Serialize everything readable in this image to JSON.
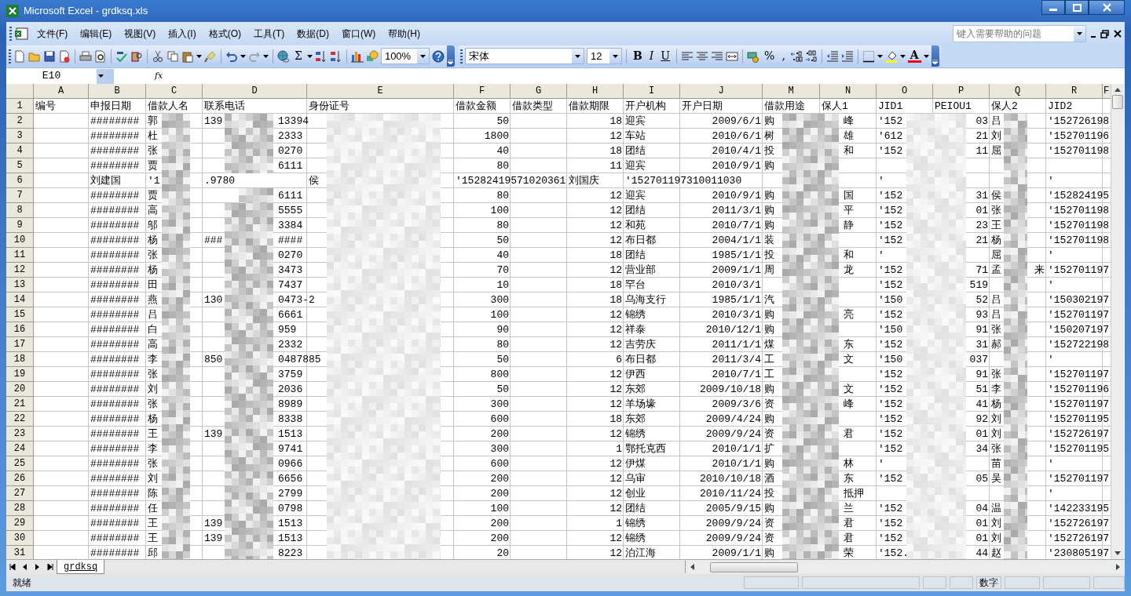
{
  "window": {
    "title": "Microsoft Excel - grdksq.xls"
  },
  "menu": [
    "文件(F)",
    "编辑(E)",
    "视图(V)",
    "插入(I)",
    "格式(O)",
    "工具(T)",
    "数据(D)",
    "窗口(W)",
    "帮助(H)"
  ],
  "help_box": {
    "placeholder": "键入需要帮助的问题"
  },
  "standard_toolbar": {
    "autosum": "Σ",
    "zoom": "100%"
  },
  "formatting_toolbar": {
    "font": "宋体",
    "size": "12",
    "styles": [
      "B",
      "I",
      "U"
    ],
    "number_formats": [
      "%",
      ","
    ],
    "font_color": "A"
  },
  "formula_bar": {
    "name_box": "E10",
    "fx": "fx"
  },
  "sheet": {
    "columns": [
      "A",
      "B",
      "C",
      "D",
      "E",
      "F",
      "G",
      "H",
      "I",
      "J",
      "M",
      "N",
      "O",
      "P",
      "Q",
      "R",
      "F"
    ],
    "rows": [
      {
        "num": "1",
        "kind": "header",
        "a": "编号",
        "b": "申报日期",
        "c": "借款人名",
        "d": "联系电话",
        "e": "身份证号",
        "f": "借款金额",
        "g": "借款类型",
        "h": "借款期限",
        "i": "开户机构",
        "j": "开户日期",
        "m": "借款用途",
        "n": "保人1",
        "o": "JID1",
        "p": "PEIOU1",
        "q": "保人2",
        "r": "JID2"
      },
      {
        "num": "2",
        "kind": "normal",
        "b": "########",
        "c": "郭",
        "d": "139",
        "d_end": "13394",
        "f": "50",
        "h": "18",
        "i": "迎宾",
        "j": "2009/6/1",
        "m": "购",
        "n": "峰",
        "o": "'152",
        "p": "03",
        "q": "吕",
        "r": "'152726198"
      },
      {
        "num": "3",
        "kind": "normal",
        "b": "########",
        "c": "杜",
        "d_end": "2333",
        "f": "1800",
        "h": "12",
        "i": "车站",
        "j": "2010/6/1",
        "m": "树",
        "n": "雄",
        "o": "'612",
        "p": "21",
        "q": "刘",
        "r": "'152701196"
      },
      {
        "num": "4",
        "kind": "normal",
        "b": "########",
        "c": "张",
        "d_end": "0270",
        "f": "40",
        "h": "18",
        "i": "团结",
        "j": "2010/4/1",
        "m": "投",
        "n": "和",
        "o": "'152",
        "p": "11",
        "q": "屈",
        "r": "'152701198"
      },
      {
        "num": "5",
        "kind": "normal",
        "b": "########",
        "c": "贾",
        "d_end": "6111",
        "f": "80",
        "h": "11",
        "i": "迎宾",
        "j": "2010/9/1",
        "m": "购"
      },
      {
        "num": "6",
        "kind": "shifted",
        "b": "刘建国",
        "c": "'1",
        "d": ".9780",
        "e": "侯",
        "f": "'15282419571020361",
        "h": "刘国庆",
        "i": "'152701197310011030",
        "o": "'",
        "r": "'"
      },
      {
        "num": "7",
        "kind": "normal",
        "b": "########",
        "c": "贾",
        "d_end": "6111",
        "f": "80",
        "h": "12",
        "i": "迎宾",
        "j": "2010/9/1",
        "m": "购",
        "n": "国",
        "o": "'152",
        "p": "31",
        "q": "侯",
        "r": "'152824195"
      },
      {
        "num": "8",
        "kind": "normal",
        "b": "########",
        "c": "高",
        "d_end": "5555",
        "f": "100",
        "h": "12",
        "i": "团结",
        "j": "2011/3/1",
        "m": "购",
        "n": "平",
        "o": "'152",
        "p": "01",
        "q": "张",
        "r": "'152701198"
      },
      {
        "num": "9",
        "kind": "normal",
        "b": "########",
        "c": "邬",
        "d_end": "3384",
        "f": "80",
        "h": "12",
        "i": "和苑",
        "j": "2010/7/1",
        "m": "购",
        "n": "静",
        "o": "'152",
        "p": "23",
        "q": "王",
        "r": "'152701198"
      },
      {
        "num": "10",
        "kind": "normal",
        "b": "########",
        "c": "杨",
        "d": "###",
        "d_end": "####",
        "f": "50",
        "h": "12",
        "i": "布日都",
        "j": "2004/1/1",
        "m": "装",
        "o": "'152",
        "p": "21",
        "q": "杨",
        "r": "'152701198"
      },
      {
        "num": "11",
        "kind": "normal",
        "b": "########",
        "c": "张",
        "d_end": "0270",
        "f": "40",
        "h": "18",
        "i": "团结",
        "j": "1985/1/1",
        "m": "投",
        "n": "和",
        "o": "'",
        "q": "屈",
        "r": "'"
      },
      {
        "num": "12",
        "kind": "normal",
        "b": "########",
        "c": "杨",
        "d_end": "3473",
        "f": "70",
        "h": "12",
        "i": "营业部",
        "j": "2009/1/1",
        "m": "周",
        "n": "龙",
        "o": "'152",
        "p": "71",
        "q": "孟",
        "q_end": "来",
        "r": "'152701197"
      },
      {
        "num": "13",
        "kind": "normal",
        "b": "########",
        "c": "田",
        "d_end": "7437",
        "f": "10",
        "h": "18",
        "i": "罕台",
        "j": "2010/3/1",
        "o": "'152",
        "p": "519",
        "r": "'"
      },
      {
        "num": "14",
        "kind": "normal",
        "b": "########",
        "c": "燕",
        "d": "130",
        "d_end": "0473-2",
        "f": "300",
        "h": "18",
        "i": "乌海支行",
        "j": "1985/1/1",
        "m": "汽",
        "o": "'150",
        "p": "52",
        "q": "吕",
        "r": "'150302197"
      },
      {
        "num": "15",
        "kind": "normal",
        "b": "########",
        "c": "吕",
        "d_end": "6661",
        "f": "100",
        "h": "12",
        "i": "锦绣",
        "j": "2010/3/1",
        "m": "购",
        "n": "亮",
        "o": "'152",
        "p": "93",
        "q": "吕",
        "r": "'152701197"
      },
      {
        "num": "16",
        "kind": "normal",
        "b": "########",
        "c": "白",
        "d_end": "959",
        "f": "90",
        "h": "12",
        "i": "祥泰",
        "j": "2010/12/1",
        "m": "购",
        "o": "'150",
        "p": "91",
        "q": "张",
        "r": "'150207197"
      },
      {
        "num": "17",
        "kind": "normal",
        "b": "########",
        "c": "高",
        "d_end": "2332",
        "f": "80",
        "h": "12",
        "i": "吉劳庆",
        "j": "2011/1/1",
        "m": "煤",
        "n": "东",
        "o": "'152",
        "p": "31",
        "q": "郝",
        "r": "'152722198"
      },
      {
        "num": "18",
        "kind": "normal",
        "b": "########",
        "c": "李",
        "d": "850",
        "d_end": "0487885",
        "f": "50",
        "h": "6",
        "i": "布日都",
        "j": "2011/3/4",
        "m": "工",
        "n": "文",
        "o": "'150",
        "p": "037",
        "r": "'"
      },
      {
        "num": "19",
        "kind": "normal",
        "b": "########",
        "c": "张",
        "d_end": "3759",
        "f": "800",
        "h": "12",
        "i": "伊西",
        "j": "2010/7/1",
        "m": "工",
        "o": "'152",
        "p": "91",
        "q": "张",
        "r": "'152701197"
      },
      {
        "num": "20",
        "kind": "normal",
        "b": "########",
        "c": "刘",
        "d_end": "2036",
        "f": "50",
        "h": "12",
        "i": "东郊",
        "j": "2009/10/18",
        "m": "购",
        "n": "文",
        "o": "'152",
        "p": "51",
        "q": "李",
        "r": "'152701196"
      },
      {
        "num": "21",
        "kind": "normal",
        "b": "########",
        "c": "张",
        "d_end": "8989",
        "f": "300",
        "h": "12",
        "i": "羊场壕",
        "j": "2009/3/6",
        "m": "资",
        "n": "峰",
        "o": "'152",
        "p": "41",
        "q": "杨",
        "r": "'152701197"
      },
      {
        "num": "22",
        "kind": "normal",
        "b": "########",
        "c": "杨",
        "d_end": "8338",
        "f": "600",
        "h": "18",
        "i": "东郊",
        "j": "2009/4/24",
        "m": "购",
        "o": "'152",
        "p": "92",
        "q": "刘",
        "r": "'152701195"
      },
      {
        "num": "23",
        "kind": "normal",
        "b": "########",
        "c": "王",
        "d": "139",
        "d_end": "1513",
        "f": "200",
        "h": "12",
        "i": "锦绣",
        "j": "2009/9/24",
        "m": "资",
        "n": "君",
        "o": "'152",
        "p": "01",
        "q": "刘",
        "r": "'152726197"
      },
      {
        "num": "24",
        "kind": "normal",
        "b": "########",
        "c": "李",
        "d_end": "9741",
        "f": "300",
        "h": "1",
        "i": "鄂托克西",
        "j": "2010/1/1",
        "m": "扩",
        "o": "'152",
        "p": "34",
        "q": "张",
        "r": "'152701195"
      },
      {
        "num": "25",
        "kind": "normal",
        "b": "########",
        "c": "张",
        "d_end": "0966",
        "f": "600",
        "h": "12",
        "i": "伊煤",
        "j": "2010/1/1",
        "m": "购",
        "n": "林",
        "o": "'",
        "q": "苗",
        "r": "'"
      },
      {
        "num": "26",
        "kind": "normal",
        "b": "########",
        "c": "刘",
        "d_end": "6656",
        "f": "200",
        "h": "12",
        "i": "乌审",
        "j": "2010/10/18",
        "m": "酒",
        "n": "东",
        "o": "'152",
        "p": "05",
        "q": "吴",
        "r": "'152701197"
      },
      {
        "num": "27",
        "kind": "normal",
        "b": "########",
        "c": "陈",
        "d_end": "2799",
        "f": "200",
        "h": "12",
        "i": "创业",
        "j": "2010/11/24",
        "m": "投",
        "n": "抵押",
        "r": "'"
      },
      {
        "num": "28",
        "kind": "normal",
        "b": "########",
        "c": "任",
        "d_end": "0798",
        "f": "100",
        "h": "12",
        "i": "团结",
        "j": "2005/9/15",
        "m": "购",
        "n": "兰",
        "o": "'152",
        "p": "04",
        "q": "温",
        "r": "'142233195"
      },
      {
        "num": "29",
        "kind": "normal",
        "b": "########",
        "c": "王",
        "d": "139",
        "d_end": "1513",
        "f": "200",
        "h": "1",
        "i": "锦绣",
        "j": "2009/9/24",
        "m": "资",
        "n": "君",
        "o": "'152",
        "p": "01",
        "q": "刘",
        "r": "'152726197"
      },
      {
        "num": "30",
        "kind": "normal",
        "b": "########",
        "c": "王",
        "d": "139",
        "d_end": "1513",
        "f": "200",
        "h": "12",
        "i": "锦绣",
        "j": "2009/9/24",
        "m": "资",
        "n": "君",
        "o": "'152",
        "p": "01",
        "q": "刘",
        "r": "'152726197"
      },
      {
        "num": "31",
        "kind": "normal",
        "b": "########",
        "c": "邱",
        "d_end": "8223",
        "f": "20",
        "h": "12",
        "i": "泊江海",
        "j": "2009/1/1",
        "m": "购",
        "n": "荣",
        "o": "'152.",
        "p": "44",
        "q": "赵",
        "r": "'230805197"
      }
    ]
  },
  "sheet_tabs": [
    {
      "label": "grdksq",
      "selected": true
    }
  ],
  "status_bar": {
    "state": "就绪",
    "mode": "数字"
  }
}
